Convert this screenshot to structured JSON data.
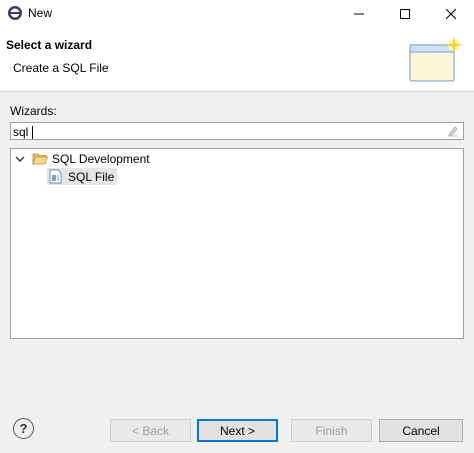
{
  "window": {
    "title": "New"
  },
  "header": {
    "title": "Select a wizard",
    "description": "Create a SQL File"
  },
  "wizards": {
    "label": "Wizards:",
    "filter_value": "sql",
    "tree": [
      {
        "label": "SQL Development",
        "expanded": true,
        "children": [
          {
            "label": "SQL File",
            "selected": true
          }
        ]
      }
    ]
  },
  "buttons": {
    "back": "< Back",
    "next": "Next >",
    "finish": "Finish",
    "cancel": "Cancel"
  }
}
